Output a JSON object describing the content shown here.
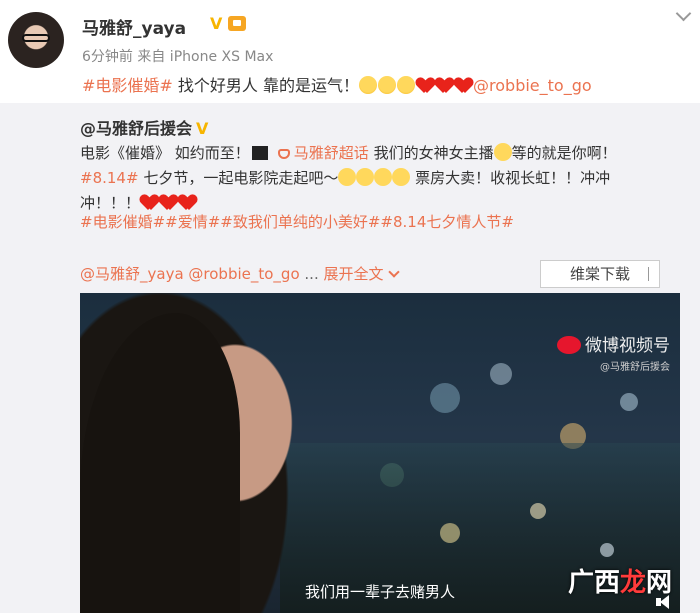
{
  "post": {
    "username": "马雅舒_yaya",
    "verified_mark": "V",
    "meta": "6分钟前 来自 iPhone XS Max",
    "text_hashtag": "#电影催婚#",
    "text_body": " 找个好男人 靠的是运气！",
    "text_mention": "@robbie_to_go"
  },
  "repost": {
    "author": "@马雅舒后援会",
    "verified_mark": "V",
    "line1_a": "电影《催婚》 如约而至！",
    "supertopic": "马雅舒超话",
    "line1_b": " 我们的女神女主播",
    "line1_c": "等的就是你啊！",
    "line2_tag": "#8.14#",
    "line2_a": " 七夕节，一起电影院走起吧～",
    "line2_b": "票房大卖！收视长虹！！冲冲",
    "line3": "冲！！！",
    "tags": "#电影催婚##爱情##致我们单纯的小美好##8.14七夕情人节#",
    "mention1": "@马雅舒_yaya",
    "mention2": "@robbie_to_go",
    "ellipsis": " ... ",
    "expand": "展开全文",
    "download": "维棠下载"
  },
  "video": {
    "watermark_title": "微博视频号",
    "watermark_sub": "@马雅舒后援会",
    "subtitle": "我们用一辈子去赌男人"
  },
  "site_mark": {
    "prefix": "广西",
    "highlight": "龙",
    "suffix": "网"
  },
  "colors": {
    "link": "#eb7350",
    "verified": "#f7b500",
    "repost_bg": "#f2f2f5"
  }
}
